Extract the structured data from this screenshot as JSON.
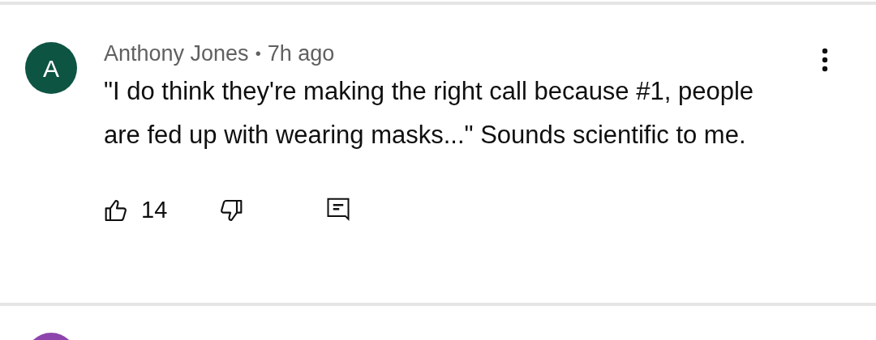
{
  "comment": {
    "avatar_letter": "A",
    "author": "Anthony Jones",
    "separator": "•",
    "time": "7h ago",
    "text": "\"I do think they're making the right call because #1, people are fed up with wearing masks...\" Sounds scientific to me.",
    "like_count": "14"
  }
}
